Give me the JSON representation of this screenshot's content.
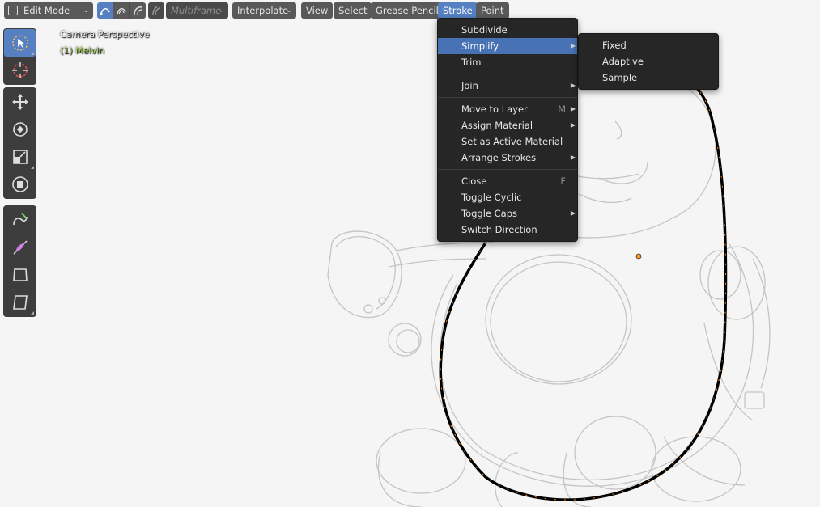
{
  "header": {
    "mode": "Edit Mode",
    "select_mode_icons": [
      "points-select-icon",
      "stroke-select-icon",
      "segment-select-icon"
    ],
    "multiframe_label": "Multiframe",
    "interpolate_label": "Interpolate",
    "menus": [
      "View",
      "Select",
      "Grease Pencil",
      "Stroke",
      "Point"
    ]
  },
  "viewport": {
    "camera_label": "Camera Perspective",
    "object_label": "(1) Melvin"
  },
  "toolbar": {
    "tools": [
      "select-box-icon",
      "cursor-icon",
      "move-icon",
      "rotate-icon",
      "scale-icon",
      "transform-icon",
      "bend-icon",
      "shear-icon",
      "to-sphere-icon",
      "transform-fill-icon"
    ]
  },
  "stroke_menu": {
    "items": [
      {
        "label": "Subdivide",
        "shortcut": "",
        "submenu": false
      },
      {
        "label": "Simplify",
        "shortcut": "",
        "submenu": true
      },
      {
        "label": "Trim",
        "shortcut": "",
        "submenu": false
      },
      {
        "label": "Join",
        "shortcut": "",
        "submenu": true
      },
      {
        "label": "Move to Layer",
        "shortcut": "M",
        "submenu": true
      },
      {
        "label": "Assign Material",
        "shortcut": "",
        "submenu": true
      },
      {
        "label": "Set as Active Material",
        "shortcut": "",
        "submenu": false
      },
      {
        "label": "Arrange Strokes",
        "shortcut": "",
        "submenu": true
      },
      {
        "label": "Close",
        "shortcut": "F",
        "submenu": false
      },
      {
        "label": "Toggle Cyclic",
        "shortcut": "",
        "submenu": false
      },
      {
        "label": "Toggle Caps",
        "shortcut": "",
        "submenu": true
      },
      {
        "label": "Switch Direction",
        "shortcut": "",
        "submenu": false
      }
    ]
  },
  "simplify_menu": {
    "items": [
      "Fixed",
      "Adaptive",
      "Sample"
    ]
  },
  "colors": {
    "accent": "#5680c2",
    "menu_bg": "#262626",
    "stroke_point": "#ff8c19",
    "object_label": "#b0e060"
  }
}
